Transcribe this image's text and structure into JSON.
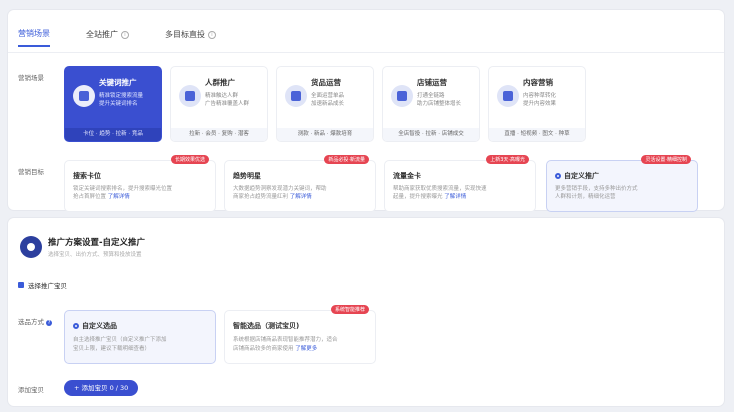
{
  "tabs": [
    {
      "label": "营销场景",
      "active": true
    },
    {
      "label": "全站推广",
      "active": false
    },
    {
      "label": "多目标直投",
      "active": false
    }
  ],
  "labels": {
    "scenario": "营销场景",
    "goal": "营销目标",
    "plan_method": "选品方式",
    "add_product": "添加宝贝"
  },
  "scenarios": [
    {
      "title": "关键词推广",
      "desc1": "精准锁定搜索流量",
      "desc2": "提升关键词排名",
      "foot": "卡位 · 趋势 · 拉新 · 竞品"
    },
    {
      "title": "人群推广",
      "desc1": "精准触达人群",
      "desc2": "广告精准覆盖人群",
      "foot": "拉新 · 会员 · 复购 · 潜客"
    },
    {
      "title": "货品运营",
      "desc1": "全面运营单品",
      "desc2": "加速新品成长",
      "foot": "测款 · 新品 · 爆款培育"
    },
    {
      "title": "店铺运营",
      "desc1": "打通全链路",
      "desc2": "助力店铺整体增长",
      "foot": "全店智投 · 拉新 · 店铺成交"
    },
    {
      "title": "内容营销",
      "desc1": "内容种草转化",
      "desc2": "提升内容效果",
      "foot": "直播 · 短视频 · 图文 · 种草"
    }
  ],
  "goals": [
    {
      "title": "搜索卡位",
      "badge": "长期效果优选",
      "desc1": "锁定关键词搜索排名，提升搜索曝光位置",
      "desc2a": "抢占首屏位置",
      "desc2b": "了解详情"
    },
    {
      "title": "趋势明星",
      "badge": "新品必投·新流量",
      "desc1": "大数据趋势洞察发现潜力关键词，帮助",
      "desc2a": "商家抢占趋势流量红利",
      "desc2b": "了解详情"
    },
    {
      "title": "流量金卡",
      "badge": "上新3天·高曝光",
      "desc1": "帮助商家获取优质搜索流量，实现快速",
      "desc2a": "起量，提升搜索曝光",
      "desc2b": "了解详情"
    },
    {
      "title": "自定义推广",
      "badge": "灵活设置·精细控制",
      "desc1": "更多营销手段，支持多种出价方式",
      "desc2a": "人群和计划，精细化运营",
      "desc2b": ""
    }
  ],
  "plan": {
    "title": "推广方案设置-自定义推广",
    "subtitle": "选择宝贝、出价方式、预算和投放设置",
    "section": "选择推广宝贝"
  },
  "plan_options": [
    {
      "title": "自定义选品",
      "badge": "",
      "desc1": "自主选择推广宝贝（自定义推广下添加",
      "desc2a": "宝贝上限，建议下载明细查看）",
      "desc2b": ""
    },
    {
      "title": "智能选品（测试宝贝)",
      "badge": "系统智能推荐",
      "desc1": "系统根据店铺商品表现智能推荐潜力，适合",
      "desc2a": "店铺商品较多的商家使用",
      "desc2b": "了解更多"
    }
  ],
  "add_button": "+ 添加宝贝 0 / 30",
  "colors": {
    "primary": "#3a4fd0",
    "badge": "#e64552",
    "background": "#eef0f5"
  }
}
